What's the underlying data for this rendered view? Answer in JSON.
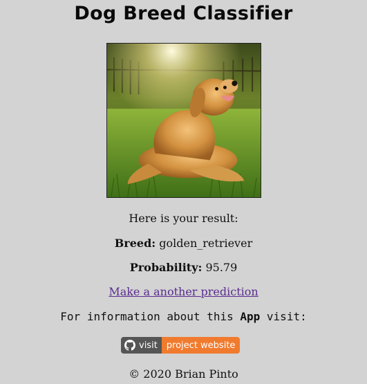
{
  "header": {
    "title": "Dog Breed Classifier"
  },
  "result": {
    "intro": "Here is your result:",
    "breed_label": "Breed:",
    "breed_value": "golden_retriever",
    "probability_label": "Probability:",
    "probability_value": "95.79",
    "again_link": "Make a another prediction"
  },
  "info": {
    "prefix": "For information about this ",
    "app_word": "App",
    "suffix": " visit:"
  },
  "badge": {
    "left_label": "visit",
    "right_label": "project website",
    "icon": "github-icon",
    "left_color": "#555555",
    "right_color": "#f07b2e"
  },
  "footer": {
    "copyright": "© 2020 Brian Pinto"
  },
  "colors": {
    "background": "#d3d3d3",
    "link": "#5a2c8f"
  }
}
